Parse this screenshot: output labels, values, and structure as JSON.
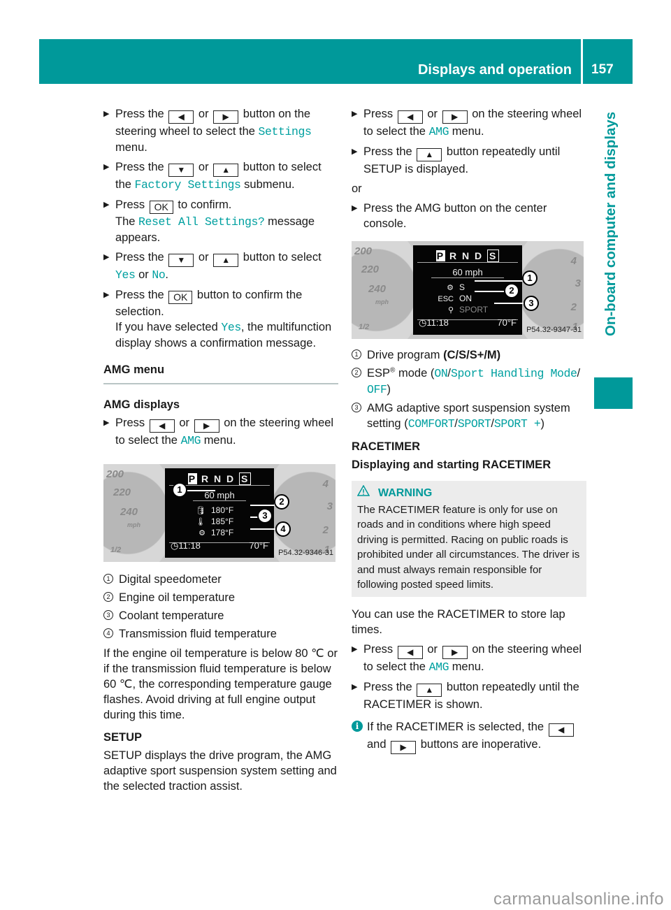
{
  "header": {
    "title": "Displays and operation",
    "page_number": "157"
  },
  "side_tab": {
    "label": "On-board computer and displays"
  },
  "colors": {
    "accent": "#00999a",
    "menu_text": "#00a0a0",
    "warning_bg": "#ececec"
  },
  "keys": {
    "left": "◀",
    "right": "▶",
    "down": "▼",
    "up": "▲",
    "ok": "OK"
  },
  "left_column": {
    "step1": {
      "a": "Press the",
      "b": "or",
      "c": "button on the steering wheel to select the",
      "menu": "Settings",
      "d": "menu."
    },
    "step2": {
      "a": "Press the",
      "b": "or",
      "c": "button to select the",
      "menu": "Factory Settings",
      "d": "submenu."
    },
    "step3": {
      "a": "Press",
      "b": "to confirm.",
      "c": "The",
      "menu": "Reset All Settings?",
      "d": "message appears."
    },
    "step4": {
      "a": "Press the",
      "b": "or",
      "c": "button to select",
      "yes": "Yes",
      "or": "or",
      "no": "No",
      "end": "."
    },
    "step5": {
      "a": "Press the",
      "b": "button to confirm the selection.",
      "c": "If you have selected",
      "yes": "Yes",
      "d": ", the multifunction display shows a confirmation message."
    },
    "amg_menu_heading": "AMG menu",
    "amg_displays_heading": "AMG displays",
    "step6": {
      "a": "Press",
      "b": "or",
      "c": "on the steering wheel to select the",
      "menu": "AMG",
      "d": "menu."
    },
    "figure1": {
      "gear": {
        "p": "P",
        "rnd": "R N D",
        "s": "S"
      },
      "speed": "60 mph",
      "rows": [
        {
          "icon": "oil-temp-icon",
          "glyph": "🛢",
          "value": "180°F"
        },
        {
          "icon": "coolant-temp-icon",
          "glyph": "🌡",
          "value": "185°F"
        },
        {
          "icon": "transmission-temp-icon",
          "glyph": "⚙",
          "value": "178°F"
        }
      ],
      "time": "11:18",
      "outside_temp": "70°F",
      "callouts": [
        "1",
        "2",
        "3",
        "4"
      ],
      "code": "P54.32-9346-31",
      "gauge_left": [
        "200",
        "220",
        "240",
        "mph",
        "1/2"
      ],
      "gauge_right": [
        "4",
        "3",
        "2",
        "1"
      ]
    },
    "legend": [
      {
        "num": "1",
        "text": "Digital speedometer"
      },
      {
        "num": "2",
        "text": "Engine oil temperature"
      },
      {
        "num": "3",
        "text": "Coolant temperature"
      },
      {
        "num": "4",
        "text": "Transmission fluid temperature"
      }
    ],
    "paragraph1": "If the engine oil temperature is below 80 ℃ or if the transmission fluid temperature is below 60 ℃, the corresponding temperature gauge flashes. Avoid driving at full engine output during this time.",
    "setup_heading": "SETUP",
    "setup_text": "SETUP displays the drive program, the AMG adaptive sport suspension system setting and the selected traction assist."
  },
  "right_column": {
    "step1": {
      "a": "Press",
      "b": "or",
      "c": "on the steering wheel to select the",
      "menu": "AMG",
      "d": "menu."
    },
    "step2": {
      "a": "Press the",
      "b": "button repeatedly until SETUP is displayed."
    },
    "or": "or",
    "step3": {
      "a": "Press the AMG button on the center console."
    },
    "figure2": {
      "gear": {
        "p": "P",
        "rnd": "R N D",
        "s": "S"
      },
      "speed": "60 mph",
      "rows": [
        {
          "icon": "drive-program-icon",
          "glyph": "⚙",
          "value": "S"
        },
        {
          "icon": "esc-icon",
          "glyph": "ESC",
          "value": "ON"
        },
        {
          "icon": "suspension-icon",
          "glyph": "⚲",
          "value": "SPORT"
        }
      ],
      "time": "11:18",
      "outside_temp": "70°F",
      "callouts": [
        "1",
        "2",
        "3"
      ],
      "code": "P54.32-9347-31",
      "gauge_left": [
        "200",
        "220",
        "240",
        "mph",
        "1/2"
      ],
      "gauge_right": [
        "4",
        "3",
        "2",
        "1"
      ]
    },
    "legend": [
      {
        "num": "1",
        "a": "Drive program ",
        "bold": "(C/S/S+/M)"
      },
      {
        "num": "2",
        "a": "ESP",
        "sup": "®",
        "b": " mode (",
        "m1": "ON",
        "s1": "/",
        "m2": "Sport Handling Mode",
        "s2": "/",
        "m3": "OFF",
        "end": ")"
      },
      {
        "num": "3",
        "a": "AMG adaptive sport suspension system setting (",
        "m1": "COMFORT",
        "s1": "/",
        "m2": "SPORT",
        "s2": "/",
        "m3": "SPORT +",
        "end": ")"
      }
    ],
    "racetimer_heading": "RACETIMER",
    "racetimer_subheading": "Displaying and starting RACETIMER",
    "warning": {
      "title": "WARNING",
      "text": "The RACETIMER feature is only for use on roads and in conditions where high speed driving is permitted. Racing on public roads is prohibited under all circumstances. The driver is and must always remain responsible for following posted speed limits."
    },
    "paragraph1": "You can use the RACETIMER to store lap times.",
    "step4": {
      "a": "Press",
      "b": "or",
      "c": "on the steering wheel to select the",
      "menu": "AMG",
      "d": "menu."
    },
    "step5": {
      "a": "Press the",
      "b": "button repeatedly until the RACETIMER is shown."
    },
    "info": {
      "a": "If the RACETIMER is selected, the",
      "b": "and",
      "c": "buttons are inoperative."
    }
  },
  "watermark": "carmanualsonline.info"
}
